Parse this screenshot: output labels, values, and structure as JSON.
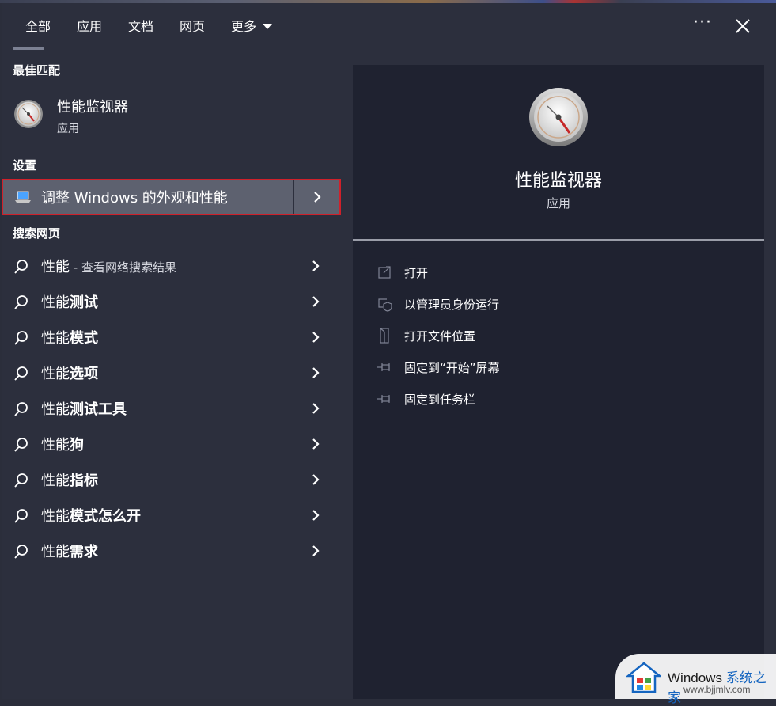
{
  "header": {
    "tabs": [
      {
        "label": "全部"
      },
      {
        "label": "应用"
      },
      {
        "label": "文档"
      },
      {
        "label": "网页"
      },
      {
        "label": "更多"
      }
    ],
    "more_dots": "···"
  },
  "left": {
    "best_match_label": "最佳匹配",
    "best_match": {
      "title": "性能监视器",
      "subtitle": "应用"
    },
    "settings_label": "设置",
    "setting_item": "调整 Windows 的外观和性能",
    "web_label": "搜索网页",
    "web_items": [
      {
        "prefix": "性能",
        "bold": "",
        "suffix": " - 查看网络搜索结果"
      },
      {
        "prefix": "性能",
        "bold": "测试",
        "suffix": ""
      },
      {
        "prefix": "性能",
        "bold": "模式",
        "suffix": ""
      },
      {
        "prefix": "性能",
        "bold": "选项",
        "suffix": ""
      },
      {
        "prefix": "性能",
        "bold": "测试工具",
        "suffix": ""
      },
      {
        "prefix": "性能",
        "bold": "狗",
        "suffix": ""
      },
      {
        "prefix": "性能",
        "bold": "指标",
        "suffix": ""
      },
      {
        "prefix": "性能",
        "bold": "模式怎么开",
        "suffix": ""
      },
      {
        "prefix": "性能",
        "bold": "需求",
        "suffix": ""
      }
    ]
  },
  "right": {
    "app_title": "性能监视器",
    "app_subtitle": "应用",
    "actions": [
      {
        "label": "打开",
        "icon": "open-icon"
      },
      {
        "label": "以管理员身份运行",
        "icon": "shield-icon"
      },
      {
        "label": "打开文件位置",
        "icon": "file-location-icon"
      },
      {
        "label": "固定到“开始”屏幕",
        "icon": "pin-icon"
      },
      {
        "label": "固定到任务栏",
        "icon": "pin-icon"
      }
    ]
  },
  "watermark": {
    "brand": "Windows",
    "brand_cn": "系统之家",
    "url": "www.bjjmlv.com"
  },
  "colors": {
    "accent_border": "#d0202a",
    "panel_bg": "#2c2f3d",
    "detail_bg": "#1f2230",
    "selected_bg": "#5d616f"
  }
}
